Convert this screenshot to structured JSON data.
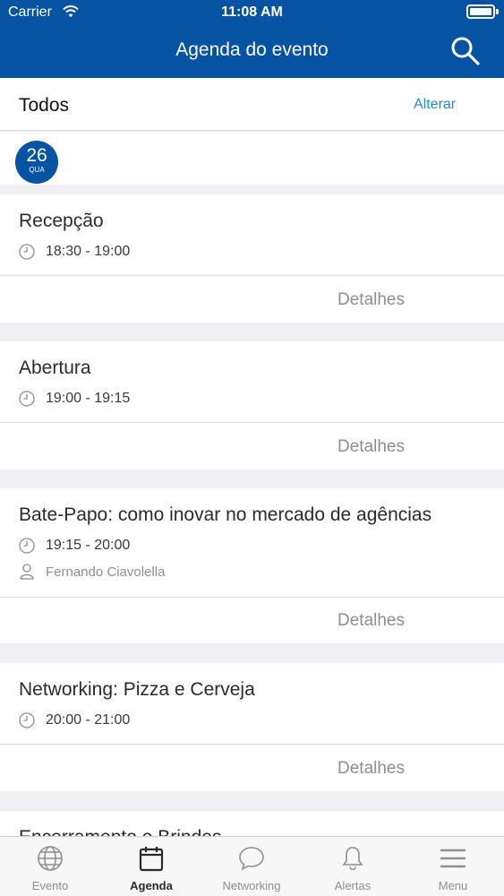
{
  "status_bar": {
    "carrier": "Carrier",
    "time": "11:08 AM"
  },
  "header": {
    "title": "Agenda do evento",
    "search_icon": "search-icon"
  },
  "filter": {
    "label": "Todos",
    "change_label": "Alterar"
  },
  "date": {
    "day": "26",
    "weekday": "QUA"
  },
  "sessions": [
    {
      "title": "Recepção",
      "time": "18:30 - 19:00",
      "details_label": "Detalhes"
    },
    {
      "title": "Abertura",
      "time": "19:00 - 19:15",
      "details_label": "Detalhes"
    },
    {
      "title": "Bate-Papo: como inovar no mercado de agências",
      "time": "19:15 - 20:00",
      "speaker": "Fernando Ciavolella",
      "details_label": "Detalhes"
    },
    {
      "title": "Networking: Pizza e Cerveja",
      "time": "20:00 - 21:00",
      "details_label": "Detalhes"
    },
    {
      "title": "Encerramento e Brindes"
    }
  ],
  "tabs": [
    {
      "label": "Evento",
      "icon": "globe-icon",
      "active": false
    },
    {
      "label": "Agenda",
      "icon": "calendar-icon",
      "active": true
    },
    {
      "label": "Networking",
      "icon": "chat-bubble-icon",
      "active": false
    },
    {
      "label": "Alertas",
      "icon": "bell-icon",
      "active": false
    },
    {
      "label": "Menu",
      "icon": "menu-icon",
      "active": false
    }
  ],
  "colors": {
    "brand": "#0553a2",
    "link": "#1d8ad6",
    "muted": "#8e8e93",
    "background": "#efeff4"
  }
}
